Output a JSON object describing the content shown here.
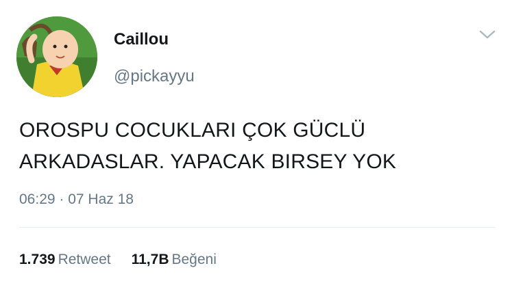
{
  "user": {
    "name": "Caillou",
    "handle": "@pickayyu"
  },
  "tweet": {
    "lines": [
      "OROSPU COCUKLARI ÇOK GÜCLÜ",
      "ARKADASLAR. YAPACAK BIRSEY YOK"
    ],
    "timestamp": "06:29 · 07 Haz 18"
  },
  "stats": {
    "retweet_count": "1.739",
    "retweet_label": "Retweet",
    "like_count": "11,7B",
    "like_label": "Beğeni"
  },
  "icons": {
    "menu": "chevron-down-icon"
  },
  "colors": {
    "text_primary": "#14171a",
    "text_secondary": "#657786",
    "divider": "#e6ecf0"
  }
}
